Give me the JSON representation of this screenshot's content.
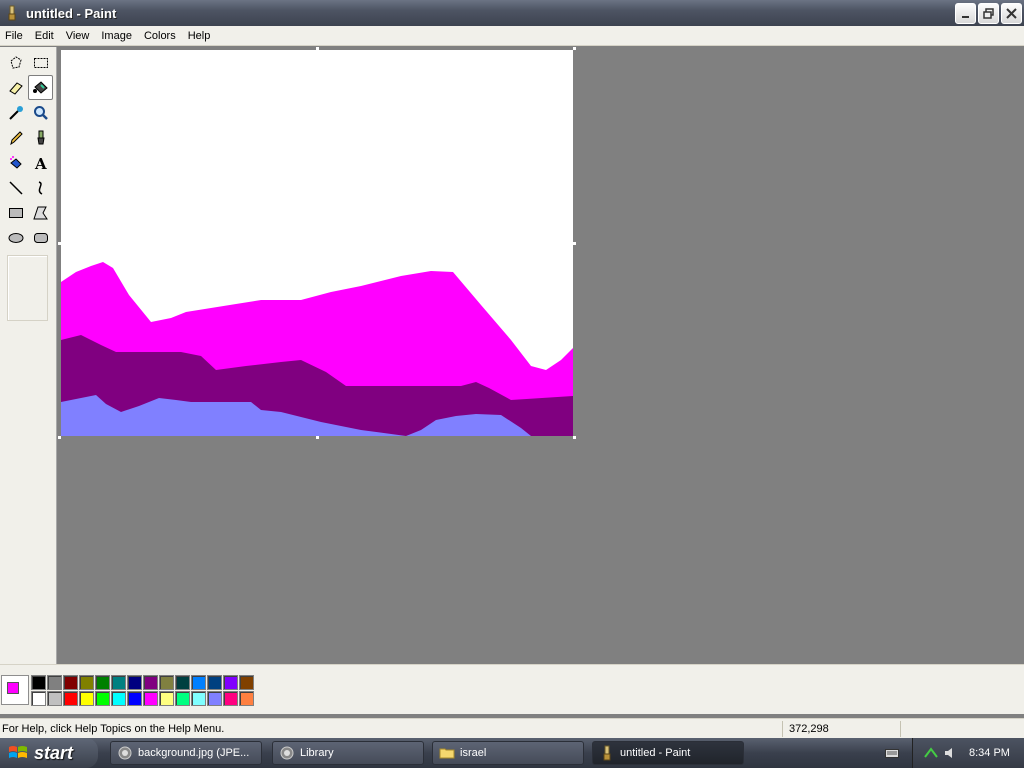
{
  "window": {
    "title": "untitled - Paint"
  },
  "menu": [
    "File",
    "Edit",
    "View",
    "Image",
    "Colors",
    "Help"
  ],
  "tools": [
    {
      "name": "free-form-select-icon"
    },
    {
      "name": "rect-select-icon"
    },
    {
      "name": "eraser-icon"
    },
    {
      "name": "fill-bucket-icon",
      "active": true
    },
    {
      "name": "color-picker-icon"
    },
    {
      "name": "magnifier-icon"
    },
    {
      "name": "pencil-icon"
    },
    {
      "name": "brush-icon"
    },
    {
      "name": "airbrush-icon"
    },
    {
      "name": "text-icon"
    },
    {
      "name": "line-icon"
    },
    {
      "name": "curve-icon"
    },
    {
      "name": "rectangle-icon"
    },
    {
      "name": "polygon-icon"
    },
    {
      "name": "ellipse-icon"
    },
    {
      "name": "rounded-rect-icon"
    }
  ],
  "colors": {
    "foreground": "#ff00ff",
    "background": "#ffffff",
    "palette_top": [
      "#000000",
      "#808080",
      "#800000",
      "#808000",
      "#008000",
      "#008080",
      "#000080",
      "#800080",
      "#808040",
      "#004040",
      "#0080ff",
      "#004080",
      "#8000ff",
      "#804000"
    ],
    "palette_bottom": [
      "#ffffff",
      "#c0c0c0",
      "#ff0000",
      "#ffff00",
      "#00ff00",
      "#00ffff",
      "#0000ff",
      "#ff00ff",
      "#ffff80",
      "#00ff80",
      "#80ffff",
      "#8080ff",
      "#ff0080",
      "#ff8040"
    ]
  },
  "status": {
    "help": "For Help, click Help Topics on the Help Menu.",
    "coords": "372,298"
  },
  "taskbar": {
    "start": "start",
    "tasks": [
      "background.jpg (JPE...",
      "Library",
      "israel",
      "untitled - Paint"
    ],
    "time": "8:34 PM"
  }
}
